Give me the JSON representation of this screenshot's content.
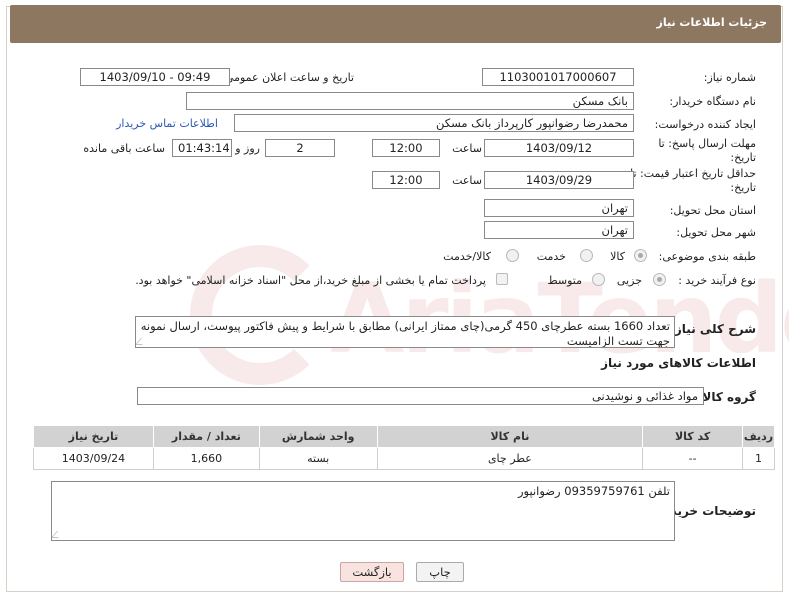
{
  "header": {
    "title": "جزئیات اطلاعات نیاز"
  },
  "form": {
    "need_number_label": "شماره نیاز:",
    "need_number": "1103001017000607",
    "announce_datetime_label": "تاریخ و ساعت اعلان عمومی:",
    "announce_datetime": "1403/09/10 - 09:49",
    "buyer_org_label": "نام دستگاه خریدار:",
    "buyer_org": "بانک مسکن",
    "requester_label": "ایجاد کننده درخواست:",
    "requester": "محمدرضا رضوانپور کارپرداز بانک مسکن",
    "contact_link": "اطلاعات تماس خریدار",
    "response_deadline_label": "مهلت ارسال پاسخ: تا تاریخ:",
    "response_date": "1403/09/12",
    "time_label": "ساعت",
    "response_time": "12:00",
    "days_value": "2",
    "days_label": "روز و",
    "remaining_time": "01:43:14",
    "remaining_label": "ساعت باقی مانده",
    "price_validity_label": "حداقل تاریخ اعتبار قیمت: تا تاریخ:",
    "price_validity_date": "1403/09/29",
    "price_validity_time": "12:00",
    "delivery_province_label": "استان محل تحویل:",
    "delivery_province": "تهران",
    "delivery_city_label": "شهر محل تحویل:",
    "delivery_city": "تهران",
    "category_label": "طبقه بندی موضوعی:",
    "category_options": [
      "کالا",
      "خدمت",
      "کالا/خدمت"
    ],
    "purchase_type_label": "نوع فرآیند خرید :",
    "purchase_options": [
      "جزیی",
      "متوسط"
    ],
    "payment_note": "پرداخت تمام یا بخشی از مبلغ خرید،از محل \"اسناد خزانه اسلامی\" خواهد بود."
  },
  "description": {
    "label": "شرح کلی نیاز:",
    "text": "تعداد 1660 بسته عطرچای 450 گرمی(چای ممتاز ایرانی) مطابق با شرایط و پیش فاکتور پیوست، ارسال نمونه جهت تست الزامیست"
  },
  "goods": {
    "section_title": "اطلاعات کالاهای مورد نیاز",
    "group_label": "گروه کالا:",
    "group_value": "مواد غذائی و نوشیدنی",
    "columns": [
      "ردیف",
      "کد کالا",
      "نام کالا",
      "واحد شمارش",
      "تعداد / مقدار",
      "تاریخ نیاز"
    ],
    "rows": [
      [
        "1",
        "--",
        "عطر چای",
        "بسته",
        "1,660",
        "1403/09/24"
      ]
    ]
  },
  "buyer_notes": {
    "label": "توضیحات خریدار:",
    "text": "تلفن 09359759761 رضوانپور"
  },
  "buttons": {
    "print": "چاپ",
    "back": "بازگشت"
  },
  "watermark": {
    "text": "AriaTender.neT"
  },
  "colors": {
    "title_bar": "#8e7760",
    "link": "#2a5ab3",
    "back_button": "#f9e3e1"
  }
}
